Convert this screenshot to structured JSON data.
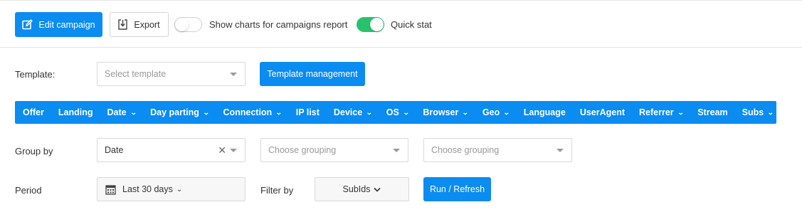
{
  "toolbar": {
    "edit_label": "Edit campaign",
    "export_label": "Export",
    "charts_toggle_label": "Show charts for campaigns report",
    "charts_toggle_on": false,
    "quickstat_toggle_label": "Quick stat",
    "quickstat_toggle_on": true
  },
  "template": {
    "label": "Template:",
    "placeholder": "Select template",
    "manage_label": "Template management"
  },
  "nav": {
    "items": [
      {
        "label": "Offer",
        "dropdown": false
      },
      {
        "label": "Landing",
        "dropdown": false
      },
      {
        "label": "Date",
        "dropdown": true
      },
      {
        "label": "Day parting",
        "dropdown": true
      },
      {
        "label": "Connection",
        "dropdown": true
      },
      {
        "label": "IP list",
        "dropdown": false
      },
      {
        "label": "Device",
        "dropdown": true
      },
      {
        "label": "OS",
        "dropdown": true
      },
      {
        "label": "Browser",
        "dropdown": true
      },
      {
        "label": "Geo",
        "dropdown": true
      },
      {
        "label": "Language",
        "dropdown": false
      },
      {
        "label": "UserAgent",
        "dropdown": false
      },
      {
        "label": "Referrer",
        "dropdown": true
      },
      {
        "label": "Stream",
        "dropdown": false
      },
      {
        "label": "Subs",
        "dropdown": true
      }
    ]
  },
  "grouping": {
    "label": "Group by",
    "group1_value": "Date",
    "group2_placeholder": "Choose grouping",
    "group3_placeholder": "Choose grouping"
  },
  "period": {
    "label": "Period",
    "value": "Last 30 days",
    "filter_label": "Filter by",
    "filter_value": "SubIds",
    "run_label": "Run / Refresh"
  },
  "colors": {
    "primary": "#0a8cf0",
    "toggle_on": "#27c26b"
  }
}
